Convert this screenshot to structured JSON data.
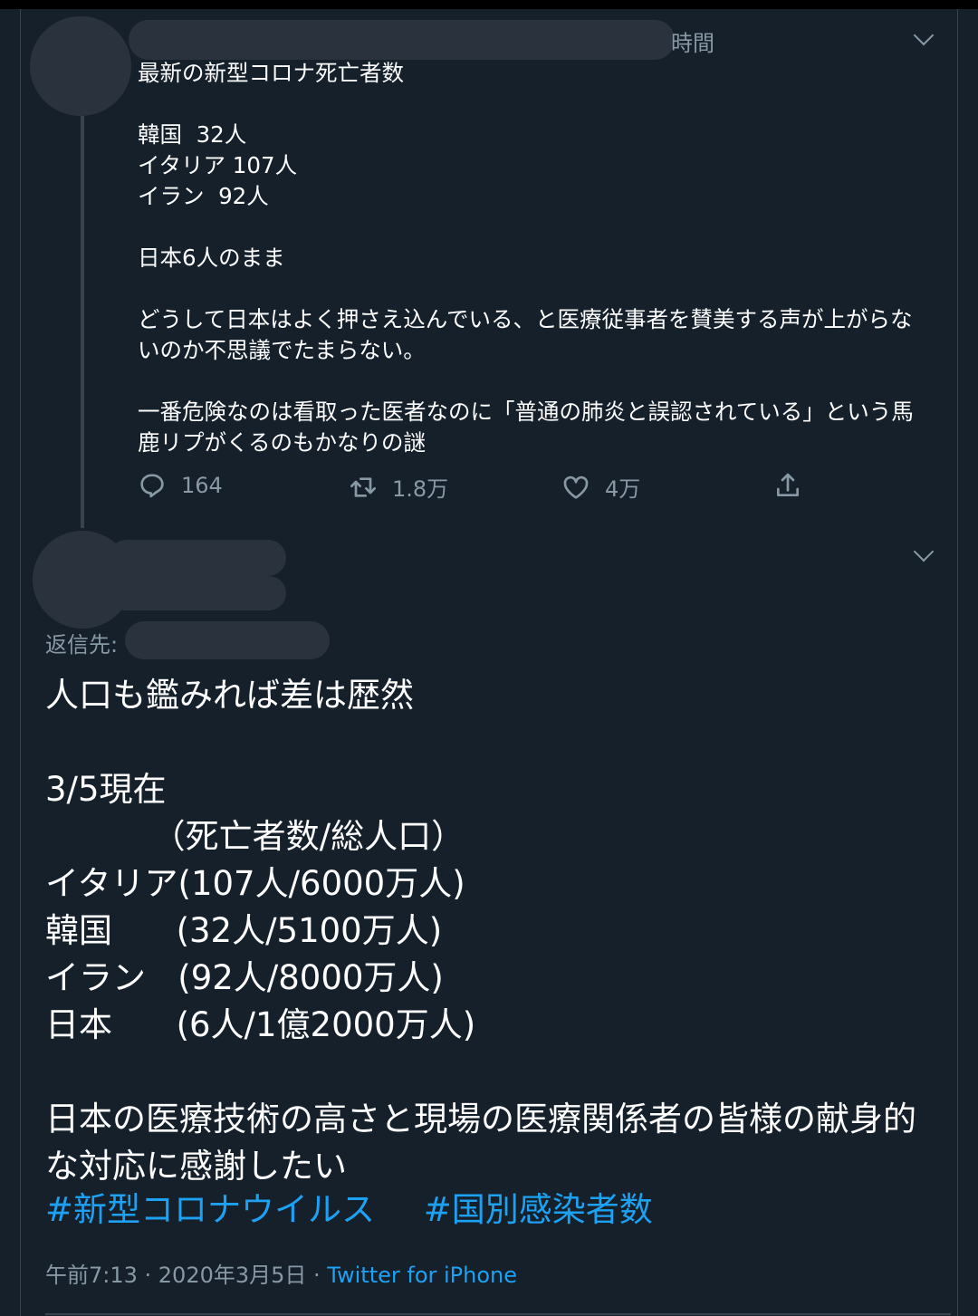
{
  "parent_tweet": {
    "time_fragment": "時間",
    "text": "最新の新型コロナ死亡者数\n\n韓国  32人\nイタリア 107人\nイラン  92人\n\n日本6人のまま\n\nどうして日本はよく押さえ込んでいる、と医療従事者を賛美する声が上がらないのか不思議でたまらない。\n\n一番危険なのは看取った医者なのに「普通の肺炎と誤認されている」という馬鹿リプがくるのもかなりの謎",
    "actions": {
      "reply_count": "164",
      "retweet_count": "1.8万",
      "like_count": "4万"
    }
  },
  "reply_tweet": {
    "reply_to_label": "返信先:",
    "text": "人口も鑑みれば差は歴然\n\n3/5現在\n          （死亡者数/総人口）\nイタリア(107人/6000万人)\n韓国      (32人/5100万人)\nイラン   (92人/8000万人)\n日本      (6人/1億2000万人)\n\n日本の医療技術の高さと現場の医療関係者の皆様の献身的な対応に感謝したい",
    "hashtags": [
      "#新型コロナウイルス",
      "#国別感染者数"
    ],
    "timestamp": "午前7:13 · 2020年3月5日 · ",
    "source": "Twitter for iPhone"
  },
  "colors": {
    "background": "#15202b",
    "text": "#ffffff",
    "secondary": "#8899a6",
    "accent": "#1da1f2",
    "divider": "#38444d"
  },
  "icons": [
    "reply-icon",
    "retweet-icon",
    "like-icon",
    "share-icon",
    "chevron-down-icon"
  ]
}
